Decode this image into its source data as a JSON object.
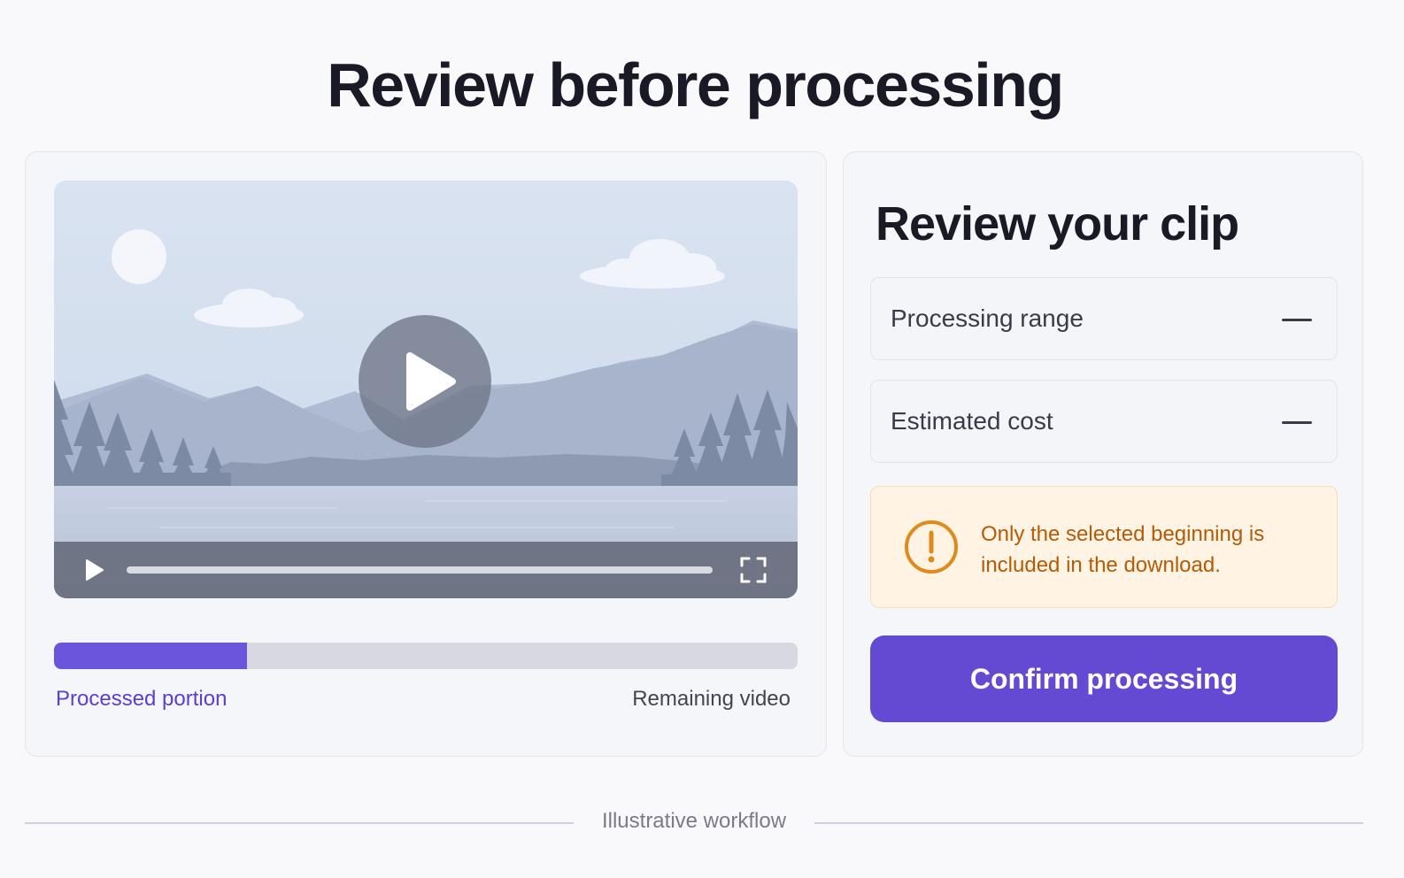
{
  "page": {
    "title": "Review before processing",
    "footer_caption": "Illustrative workflow"
  },
  "player": {
    "thumbnail": "landscape-lake-mountains",
    "big_play_icon": "play-icon",
    "controls": {
      "play_icon": "play-icon",
      "fullscreen_icon": "fullscreen-icon"
    }
  },
  "progress": {
    "processed_fraction": 0.26,
    "processed_label": "Processed portion",
    "remaining_label": "Remaining video",
    "processed_color": "#6a55dc",
    "remaining_color": "#d8d9e0"
  },
  "review": {
    "title": "Review your clip",
    "rows": [
      {
        "label": "Processing range",
        "value": "—"
      },
      {
        "label": "Estimated cost",
        "value": "—"
      }
    ],
    "warning": {
      "icon": "exclamation-circle-icon",
      "text": "Only the selected beginning is included in the download.",
      "color": "#e08a1b"
    },
    "confirm_label": "Confirm processing",
    "accent_color": "#6449d2"
  }
}
